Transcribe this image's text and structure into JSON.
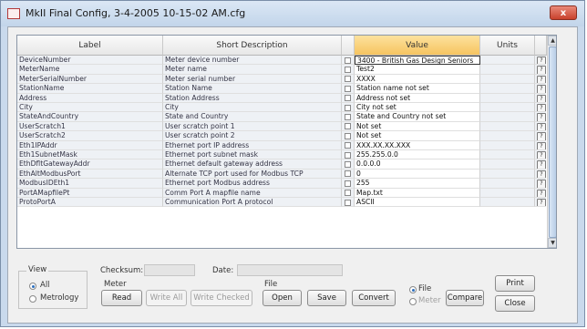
{
  "window": {
    "title": "MkII Final Config, 3-4-2005 10-15-02 AM.cfg",
    "close_glyph": "x"
  },
  "grid": {
    "columns": {
      "label": "Label",
      "description": "Short Description",
      "value": "Value",
      "units": "Units"
    },
    "rows": [
      {
        "label": "DeviceNumber",
        "description": "Meter device number",
        "value": "3400 - British Gas Design Seniors",
        "units": ""
      },
      {
        "label": "MeterName",
        "description": "Meter name",
        "value": "Test2",
        "units": ""
      },
      {
        "label": "MeterSerialNumber",
        "description": "Meter serial number",
        "value": "XXXX",
        "units": ""
      },
      {
        "label": "StationName",
        "description": "Station Name",
        "value": "Station name not set",
        "units": ""
      },
      {
        "label": "Address",
        "description": "Station Address",
        "value": "Address not set",
        "units": ""
      },
      {
        "label": "City",
        "description": "City",
        "value": "City not set",
        "units": ""
      },
      {
        "label": "StateAndCountry",
        "description": "State and Country",
        "value": "State and Country not set",
        "units": ""
      },
      {
        "label": "UserScratch1",
        "description": "User scratch point 1",
        "value": "Not set",
        "units": ""
      },
      {
        "label": "UserScratch2",
        "description": "User scratch point 2",
        "value": "Not set",
        "units": ""
      },
      {
        "label": "Eth1IPAddr",
        "description": "Ethernet port IP address",
        "value": "XXX.XX.XX.XXX",
        "units": ""
      },
      {
        "label": "Eth1SubnetMask",
        "description": "Ethernet port subnet mask",
        "value": "255.255.0.0",
        "units": ""
      },
      {
        "label": "EthDfltGatewayAddr",
        "description": "Ethernet default gateway address",
        "value": "0.0.0.0",
        "units": ""
      },
      {
        "label": "EthAltModbusPort",
        "description": "Alternate TCP port used for Modbus TCP",
        "value": "0",
        "units": ""
      },
      {
        "label": "ModbusIDEth1",
        "description": "Ethernet port Modbus address",
        "value": "255",
        "units": ""
      },
      {
        "label": "PortAMapfilePt",
        "description": "Comm Port A mapfile name",
        "value": "Map.txt",
        "units": ""
      },
      {
        "label": "ProtoPortA",
        "description": "Communication Port A protocol",
        "value": "ASCII",
        "units": ""
      }
    ],
    "help_glyph": "?",
    "scroll_up_glyph": "▲",
    "scroll_down_glyph": "▼"
  },
  "view": {
    "group_label": "View",
    "all_label": "All",
    "all_selected": true,
    "metrology_label": "Metrology"
  },
  "info": {
    "checksum_label": "Checksum:",
    "checksum_value": "",
    "date_label": "Date:",
    "date_value": ""
  },
  "meter": {
    "group_label": "Meter",
    "read_label": "Read",
    "write_all_label": "Write All",
    "write_checked_label": "Write Checked"
  },
  "file": {
    "group_label": "File",
    "open_label": "Open",
    "save_label": "Save",
    "convert_label": "Convert",
    "file_radio_label": "File",
    "file_selected": true,
    "meter_radio_label": "Meter",
    "compare_label": "Compare"
  },
  "actions": {
    "print_label": "Print",
    "close_label": "Close"
  }
}
